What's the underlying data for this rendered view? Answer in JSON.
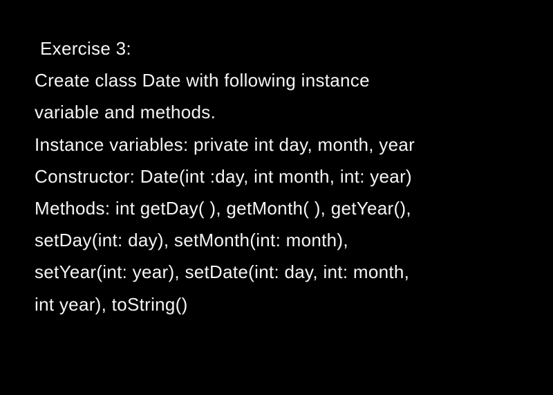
{
  "exercise": {
    "title": "Exercise 3:",
    "line1": "Create class Date with following instance",
    "line2": "variable and methods.",
    "line3": "Instance variables: private int day, month, year",
    "line4": "Constructor: Date(int :day, int month, int: year)",
    "line5": "Methods: int getDay( ), getMonth( ), getYear(),",
    "line6": "setDay(int: day), setMonth(int: month),",
    "line7": "setYear(int: year), setDate(int: day, int: month,",
    "line8": "int year), toString()"
  }
}
